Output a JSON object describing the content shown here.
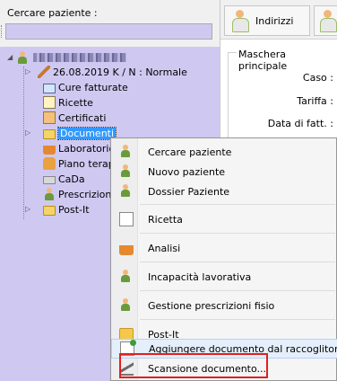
{
  "search": {
    "label": "Cercare paziente :",
    "value": ""
  },
  "tree": {
    "items": [
      {
        "label": "26.08.2019 K / N : Normale",
        "icon": "pen-icon"
      },
      {
        "label": "Cure fatturate",
        "icon": "card-icon"
      },
      {
        "label": "Ricette",
        "icon": "doc-icon"
      },
      {
        "label": "Certificati",
        "icon": "certificate-icon"
      },
      {
        "label": "Documenti",
        "icon": "folder-icon"
      },
      {
        "label": "Laboratorio,",
        "icon": "lab-icon"
      },
      {
        "label": "Piano terapi",
        "icon": "bottle-icon"
      },
      {
        "label": "CaDa",
        "icon": "keyboard-icon"
      },
      {
        "label": "Prescrizioni",
        "icon": "person-icon"
      },
      {
        "label": "Post-It",
        "icon": "folder-icon"
      }
    ]
  },
  "toolbar": {
    "address_label": "Indirizzi"
  },
  "form": {
    "title": "Maschera principale",
    "caso_label": "Caso :",
    "tariffa_label": "Tariffa :",
    "data_label": "Data di fatt. :"
  },
  "context_menu": {
    "items": [
      {
        "label": "Cercare paziente",
        "icon": "person-search-icon"
      },
      {
        "label": "Nuovo paziente",
        "icon": "person-add-icon"
      },
      {
        "label": "Dossier Paziente",
        "icon": "person-dossier-icon"
      },
      {
        "label": "Ricetta",
        "icon": "prescription-icon"
      },
      {
        "label": "Analisi",
        "icon": "lab-icon"
      },
      {
        "label": "Incapacità lavorativa",
        "icon": "person-icon"
      },
      {
        "label": "Gestione prescrizioni fisio",
        "icon": "person-icon"
      },
      {
        "label": "Post-It",
        "icon": "folder-icon"
      },
      {
        "label": "Aggiungere documento dal raccoglitore",
        "icon": "document-add-icon"
      },
      {
        "label": "Scansione documento...",
        "icon": "scanner-icon"
      }
    ]
  },
  "colors": {
    "tree_background": "#cfc9f2",
    "highlight_box": "#e02020",
    "menu_hover": "#e5effb"
  }
}
